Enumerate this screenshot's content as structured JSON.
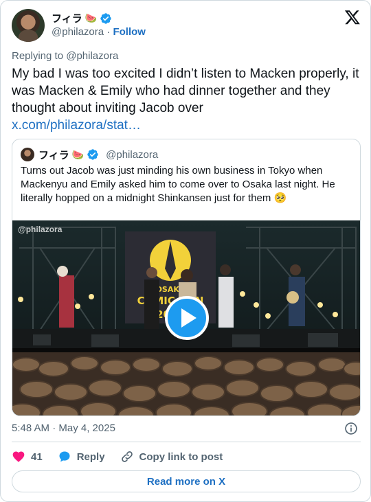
{
  "author": {
    "display_name": "フィラ",
    "name_emoji": "🍉",
    "handle": "@philazora",
    "separator": "·",
    "follow_label": "Follow"
  },
  "icons": {
    "verified": "verified-badge-icon",
    "platform": "x-logo-icon",
    "info": "info-icon",
    "like": "heart-icon",
    "reply": "speech-bubble-icon",
    "copy": "link-icon",
    "play": "play-icon"
  },
  "colors": {
    "link": "#1d6fc2",
    "verified": "#1d9bf0",
    "like": "#f91880",
    "reply": "#1d9bf0",
    "muted": "#536471"
  },
  "tweet": {
    "replying_to": "Replying to @philazora",
    "text": "My bad I was too excited I didn’t listen to Macken properly, it was Macken & Emily who had dinner together and they thought about inviting Jacob over",
    "link": "x.com/philazora/stat…"
  },
  "quoted": {
    "display_name": "フィラ",
    "name_emoji": "🍉",
    "handle": "@philazora",
    "text": "Turns out Jacob was just minding his own business in Tokyo when Mackenyu and Emily asked him to come over to Osaka last night. He literally hopped on a midnight Shinkansen just for them 🥺",
    "media": {
      "watermark": "@philazora",
      "banner_text_1": "OSAKA",
      "banner_text_2": "COMIC CON",
      "banner_text_3": "2025"
    }
  },
  "meta": {
    "timestamp": "5:48 AM · May 4, 2025"
  },
  "actions": {
    "like_count": "41",
    "reply_label": "Reply",
    "copy_label": "Copy link to post"
  },
  "read_more_label": "Read more on X"
}
